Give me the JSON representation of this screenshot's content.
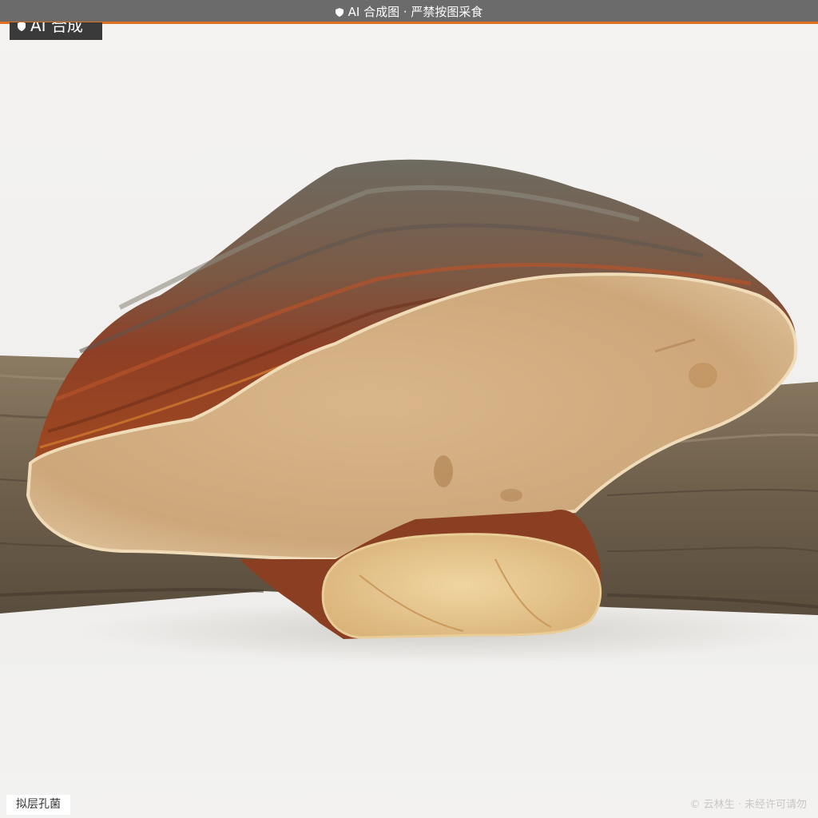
{
  "banner": {
    "text": "AI 合成图 · 严禁按图采食",
    "icon": "shield-icon"
  },
  "ai_tag": {
    "text": "AI 合成",
    "icon": "shield-icon"
  },
  "species_label": {
    "text": "拟层孔菌"
  },
  "watermark": {
    "text": "© 云林生 · 未经许可请勿"
  },
  "colors": {
    "banner_bg": "#6b6b6b",
    "banner_accent": "#e0701e",
    "background": "#f2f1ef",
    "cap_brown": "#8a3f26",
    "cap_grey": "#6d6a5e",
    "pore_surface": "#d2ae82",
    "log_bark": "#7a6a55"
  },
  "image": {
    "subject": "bracket fungus on a log"
  }
}
